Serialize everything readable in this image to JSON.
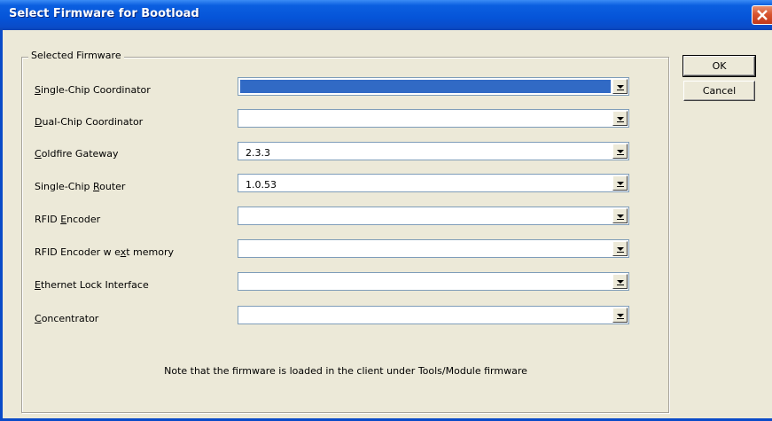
{
  "window": {
    "title": "Select Firmware for Bootload"
  },
  "group": {
    "legend": "Selected Firmware"
  },
  "rows": [
    {
      "label_pre": "",
      "label_u": "S",
      "label_post": "ingle-Chip Coordinator",
      "value": "",
      "selected": true
    },
    {
      "label_pre": "",
      "label_u": "D",
      "label_post": "ual-Chip Coordinator",
      "value": ""
    },
    {
      "label_pre": "",
      "label_u": "C",
      "label_post": "oldfire Gateway",
      "value": "2.3.3"
    },
    {
      "label_pre": "Single-Chip ",
      "label_u": "R",
      "label_post": "outer",
      "value": "1.0.53"
    },
    {
      "label_pre": "RFID ",
      "label_u": "E",
      "label_post": "ncoder",
      "value": ""
    },
    {
      "label_pre": "RFID Encoder w e",
      "label_u": "x",
      "label_post": "t memory",
      "value": ""
    },
    {
      "label_pre": "",
      "label_u": "E",
      "label_post": "thernet Lock Interface",
      "value": ""
    },
    {
      "label_pre": "",
      "label_u": "C",
      "label_post": "oncentrator",
      "value": ""
    }
  ],
  "note": "Note that the firmware is loaded in the client under Tools/Module firmware",
  "buttons": {
    "ok": "OK",
    "cancel": "Cancel"
  },
  "colors": {
    "titlebar": "#0554d8",
    "selection": "#316ac5",
    "dialog_bg": "#ece9d8"
  }
}
